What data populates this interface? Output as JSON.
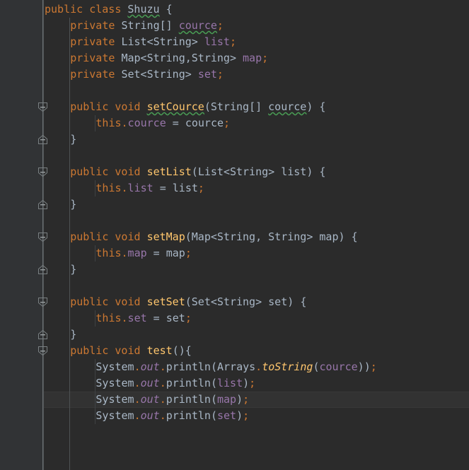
{
  "editor": {
    "name": "code-editor",
    "language": "Java",
    "background": "#2b2b2b",
    "gutter_background": "#313335",
    "caret_line_background": "#323232",
    "caret_line_number": 25,
    "line_height_px": 23,
    "font_size_px": 15
  },
  "colors": {
    "keyword": "#cc7832",
    "type": "#a9b7c6",
    "field": "#9876aa",
    "method": "#ffc66d",
    "plain": "#a9b7c6",
    "punctuation": "#cc7832",
    "typo_underline": "#499c54",
    "gutter_line": "#6b7072",
    "indent_guide": "#4e5254"
  },
  "code": {
    "lines": [
      {
        "n": 1,
        "indent": 0,
        "tokens": [
          {
            "t": "public",
            "c": "kw"
          },
          {
            "t": " ",
            "c": "plain"
          },
          {
            "t": "class",
            "c": "kw"
          },
          {
            "t": " ",
            "c": "plain"
          },
          {
            "t": "Shuzu",
            "c": "type typo"
          },
          {
            "t": " ",
            "c": "plain"
          },
          {
            "t": "{",
            "c": "brace"
          }
        ]
      },
      {
        "n": 2,
        "indent": 1,
        "tokens": [
          {
            "t": "private",
            "c": "kw"
          },
          {
            "t": " ",
            "c": "plain"
          },
          {
            "t": "String",
            "c": "type"
          },
          {
            "t": "[]",
            "c": "plain"
          },
          {
            "t": " ",
            "c": "plain"
          },
          {
            "t": "cource",
            "c": "field typo"
          },
          {
            "t": ";",
            "c": "semi"
          }
        ]
      },
      {
        "n": 3,
        "indent": 1,
        "tokens": [
          {
            "t": "private",
            "c": "kw"
          },
          {
            "t": " ",
            "c": "plain"
          },
          {
            "t": "List",
            "c": "type"
          },
          {
            "t": "<",
            "c": "plain"
          },
          {
            "t": "String",
            "c": "type"
          },
          {
            "t": ">",
            "c": "plain"
          },
          {
            "t": " ",
            "c": "plain"
          },
          {
            "t": "list",
            "c": "field"
          },
          {
            "t": ";",
            "c": "semi"
          }
        ]
      },
      {
        "n": 4,
        "indent": 1,
        "tokens": [
          {
            "t": "private",
            "c": "kw"
          },
          {
            "t": " ",
            "c": "plain"
          },
          {
            "t": "Map",
            "c": "type"
          },
          {
            "t": "<",
            "c": "plain"
          },
          {
            "t": "String",
            "c": "type"
          },
          {
            "t": ",",
            "c": "plain"
          },
          {
            "t": "String",
            "c": "type"
          },
          {
            "t": ">",
            "c": "plain"
          },
          {
            "t": " ",
            "c": "plain"
          },
          {
            "t": "map",
            "c": "field"
          },
          {
            "t": ";",
            "c": "semi"
          }
        ]
      },
      {
        "n": 5,
        "indent": 1,
        "tokens": [
          {
            "t": "private",
            "c": "kw"
          },
          {
            "t": " ",
            "c": "plain"
          },
          {
            "t": "Set",
            "c": "type"
          },
          {
            "t": "<",
            "c": "plain"
          },
          {
            "t": "String",
            "c": "type"
          },
          {
            "t": ">",
            "c": "plain"
          },
          {
            "t": " ",
            "c": "plain"
          },
          {
            "t": "set",
            "c": "field"
          },
          {
            "t": ";",
            "c": "semi"
          }
        ]
      },
      {
        "n": 6,
        "indent": 0,
        "tokens": []
      },
      {
        "n": 7,
        "indent": 1,
        "tokens": [
          {
            "t": "public",
            "c": "kw"
          },
          {
            "t": " ",
            "c": "plain"
          },
          {
            "t": "void",
            "c": "kw"
          },
          {
            "t": " ",
            "c": "plain"
          },
          {
            "t": "setCource",
            "c": "meth typo"
          },
          {
            "t": "(",
            "c": "plain"
          },
          {
            "t": "String",
            "c": "type"
          },
          {
            "t": "[]",
            "c": "plain"
          },
          {
            "t": " ",
            "c": "plain"
          },
          {
            "t": "cource",
            "c": "plain typo"
          },
          {
            "t": ")",
            "c": "plain"
          },
          {
            "t": " ",
            "c": "plain"
          },
          {
            "t": "{",
            "c": "brace"
          }
        ]
      },
      {
        "n": 8,
        "indent": 2,
        "tokens": [
          {
            "t": "this",
            "c": "kw"
          },
          {
            "t": ".",
            "c": "semi"
          },
          {
            "t": "cource",
            "c": "field"
          },
          {
            "t": " ",
            "c": "plain"
          },
          {
            "t": "=",
            "c": "plain"
          },
          {
            "t": " ",
            "c": "plain"
          },
          {
            "t": "cource",
            "c": "plain"
          },
          {
            "t": ";",
            "c": "semi"
          }
        ]
      },
      {
        "n": 9,
        "indent": 1,
        "tokens": [
          {
            "t": "}",
            "c": "brace"
          }
        ]
      },
      {
        "n": 10,
        "indent": 0,
        "tokens": []
      },
      {
        "n": 11,
        "indent": 1,
        "tokens": [
          {
            "t": "public",
            "c": "kw"
          },
          {
            "t": " ",
            "c": "plain"
          },
          {
            "t": "void",
            "c": "kw"
          },
          {
            "t": " ",
            "c": "plain"
          },
          {
            "t": "setList",
            "c": "meth"
          },
          {
            "t": "(",
            "c": "plain"
          },
          {
            "t": "List",
            "c": "type"
          },
          {
            "t": "<",
            "c": "plain"
          },
          {
            "t": "String",
            "c": "type"
          },
          {
            "t": ">",
            "c": "plain"
          },
          {
            "t": " ",
            "c": "plain"
          },
          {
            "t": "list",
            "c": "plain"
          },
          {
            "t": ")",
            "c": "plain"
          },
          {
            "t": " ",
            "c": "plain"
          },
          {
            "t": "{",
            "c": "brace"
          }
        ]
      },
      {
        "n": 12,
        "indent": 2,
        "tokens": [
          {
            "t": "this",
            "c": "kw"
          },
          {
            "t": ".",
            "c": "semi"
          },
          {
            "t": "list",
            "c": "field"
          },
          {
            "t": " ",
            "c": "plain"
          },
          {
            "t": "=",
            "c": "plain"
          },
          {
            "t": " ",
            "c": "plain"
          },
          {
            "t": "list",
            "c": "plain"
          },
          {
            "t": ";",
            "c": "semi"
          }
        ]
      },
      {
        "n": 13,
        "indent": 1,
        "tokens": [
          {
            "t": "}",
            "c": "brace"
          }
        ]
      },
      {
        "n": 14,
        "indent": 0,
        "tokens": []
      },
      {
        "n": 15,
        "indent": 1,
        "tokens": [
          {
            "t": "public",
            "c": "kw"
          },
          {
            "t": " ",
            "c": "plain"
          },
          {
            "t": "void",
            "c": "kw"
          },
          {
            "t": " ",
            "c": "plain"
          },
          {
            "t": "setMap",
            "c": "meth"
          },
          {
            "t": "(",
            "c": "plain"
          },
          {
            "t": "Map",
            "c": "type"
          },
          {
            "t": "<",
            "c": "plain"
          },
          {
            "t": "String",
            "c": "type"
          },
          {
            "t": ",",
            "c": "plain"
          },
          {
            "t": " ",
            "c": "plain"
          },
          {
            "t": "String",
            "c": "type"
          },
          {
            "t": ">",
            "c": "plain"
          },
          {
            "t": " ",
            "c": "plain"
          },
          {
            "t": "map",
            "c": "plain"
          },
          {
            "t": ")",
            "c": "plain"
          },
          {
            "t": " ",
            "c": "plain"
          },
          {
            "t": "{",
            "c": "brace"
          }
        ]
      },
      {
        "n": 16,
        "indent": 2,
        "tokens": [
          {
            "t": "this",
            "c": "kw"
          },
          {
            "t": ".",
            "c": "semi"
          },
          {
            "t": "map",
            "c": "field"
          },
          {
            "t": " ",
            "c": "plain"
          },
          {
            "t": "=",
            "c": "plain"
          },
          {
            "t": " ",
            "c": "plain"
          },
          {
            "t": "map",
            "c": "plain"
          },
          {
            "t": ";",
            "c": "semi"
          }
        ]
      },
      {
        "n": 17,
        "indent": 1,
        "tokens": [
          {
            "t": "}",
            "c": "brace"
          }
        ]
      },
      {
        "n": 18,
        "indent": 0,
        "tokens": []
      },
      {
        "n": 19,
        "indent": 1,
        "tokens": [
          {
            "t": "public",
            "c": "kw"
          },
          {
            "t": " ",
            "c": "plain"
          },
          {
            "t": "void",
            "c": "kw"
          },
          {
            "t": " ",
            "c": "plain"
          },
          {
            "t": "setSet",
            "c": "meth"
          },
          {
            "t": "(",
            "c": "plain"
          },
          {
            "t": "Set",
            "c": "type"
          },
          {
            "t": "<",
            "c": "plain"
          },
          {
            "t": "String",
            "c": "type"
          },
          {
            "t": ">",
            "c": "plain"
          },
          {
            "t": " ",
            "c": "plain"
          },
          {
            "t": "set",
            "c": "plain"
          },
          {
            "t": ")",
            "c": "plain"
          },
          {
            "t": " ",
            "c": "plain"
          },
          {
            "t": "{",
            "c": "brace"
          }
        ]
      },
      {
        "n": 20,
        "indent": 2,
        "tokens": [
          {
            "t": "this",
            "c": "kw"
          },
          {
            "t": ".",
            "c": "semi"
          },
          {
            "t": "set",
            "c": "field"
          },
          {
            "t": " ",
            "c": "plain"
          },
          {
            "t": "=",
            "c": "plain"
          },
          {
            "t": " ",
            "c": "plain"
          },
          {
            "t": "set",
            "c": "plain"
          },
          {
            "t": ";",
            "c": "semi"
          }
        ]
      },
      {
        "n": 21,
        "indent": 1,
        "tokens": [
          {
            "t": "}",
            "c": "brace"
          }
        ]
      },
      {
        "n": 22,
        "indent": 1,
        "tokens": [
          {
            "t": "public",
            "c": "kw"
          },
          {
            "t": " ",
            "c": "plain"
          },
          {
            "t": "void",
            "c": "kw"
          },
          {
            "t": " ",
            "c": "plain"
          },
          {
            "t": "test",
            "c": "meth"
          },
          {
            "t": "()",
            "c": "plain"
          },
          {
            "t": "{",
            "c": "brace"
          }
        ]
      },
      {
        "n": 23,
        "indent": 2,
        "tokens": [
          {
            "t": "System",
            "c": "type"
          },
          {
            "t": ".",
            "c": "semi"
          },
          {
            "t": "out",
            "c": "field-i"
          },
          {
            "t": ".",
            "c": "semi"
          },
          {
            "t": "println",
            "c": "plain"
          },
          {
            "t": "(",
            "c": "plain"
          },
          {
            "t": "Arrays",
            "c": "type"
          },
          {
            "t": ".",
            "c": "semi"
          },
          {
            "t": "toString",
            "c": "meth-i"
          },
          {
            "t": "(",
            "c": "plain"
          },
          {
            "t": "cource",
            "c": "field"
          },
          {
            "t": "))",
            "c": "plain"
          },
          {
            "t": ";",
            "c": "semi"
          }
        ]
      },
      {
        "n": 24,
        "indent": 2,
        "tokens": [
          {
            "t": "System",
            "c": "type"
          },
          {
            "t": ".",
            "c": "semi"
          },
          {
            "t": "out",
            "c": "field-i"
          },
          {
            "t": ".",
            "c": "semi"
          },
          {
            "t": "println",
            "c": "plain"
          },
          {
            "t": "(",
            "c": "plain"
          },
          {
            "t": "list",
            "c": "field"
          },
          {
            "t": ")",
            "c": "plain"
          },
          {
            "t": ";",
            "c": "semi"
          }
        ]
      },
      {
        "n": 25,
        "indent": 2,
        "tokens": [
          {
            "t": "System",
            "c": "type"
          },
          {
            "t": ".",
            "c": "semi"
          },
          {
            "t": "out",
            "c": "field-i"
          },
          {
            "t": ".",
            "c": "semi"
          },
          {
            "t": "println",
            "c": "plain"
          },
          {
            "t": "(",
            "c": "plain"
          },
          {
            "t": "map",
            "c": "field"
          },
          {
            "t": ")",
            "c": "plain"
          },
          {
            "t": ";",
            "c": "semi"
          }
        ]
      },
      {
        "n": 26,
        "indent": 2,
        "tokens": [
          {
            "t": "System",
            "c": "type"
          },
          {
            "t": ".",
            "c": "semi"
          },
          {
            "t": "out",
            "c": "field-i"
          },
          {
            "t": ".",
            "c": "semi"
          },
          {
            "t": "println",
            "c": "plain"
          },
          {
            "t": "(",
            "c": "plain"
          },
          {
            "t": "set",
            "c": "field"
          },
          {
            "t": ")",
            "c": "plain"
          },
          {
            "t": ";",
            "c": "semi"
          }
        ]
      }
    ],
    "plain_text": "public class Shuzu {\n    private String[] cource;\n    private List<String> list;\n    private Map<String,String> map;\n    private Set<String> set;\n\n    public void setCource(String[] cource) {\n        this.cource = cource;\n    }\n\n    public void setList(List<String> list) {\n        this.list = list;\n    }\n\n    public void setMap(Map<String, String> map) {\n        this.map = map;\n    }\n\n    public void setSet(Set<String> set) {\n        this.set = set;\n    }\n    public void test(){\n        System.out.println(Arrays.toString(cource));\n        System.out.println(list);\n        System.out.println(map);\n        System.out.println(set);"
  },
  "gutter": {
    "fold_markers": [
      {
        "name": "fold-marker-setCource-open",
        "line": 7,
        "state": "expanded",
        "kind": "start"
      },
      {
        "name": "fold-marker-setCource-close",
        "line": 9,
        "state": "expanded",
        "kind": "end"
      },
      {
        "name": "fold-marker-setList-open",
        "line": 11,
        "state": "expanded",
        "kind": "start"
      },
      {
        "name": "fold-marker-setList-close",
        "line": 13,
        "state": "expanded",
        "kind": "end"
      },
      {
        "name": "fold-marker-setMap-open",
        "line": 15,
        "state": "expanded",
        "kind": "start"
      },
      {
        "name": "fold-marker-setMap-close",
        "line": 17,
        "state": "expanded",
        "kind": "end"
      },
      {
        "name": "fold-marker-setSet-open",
        "line": 19,
        "state": "expanded",
        "kind": "start"
      },
      {
        "name": "fold-marker-setSet-close",
        "line": 21,
        "state": "expanded",
        "kind": "end"
      },
      {
        "name": "fold-marker-test-open",
        "line": 22,
        "state": "expanded",
        "kind": "start"
      }
    ]
  }
}
